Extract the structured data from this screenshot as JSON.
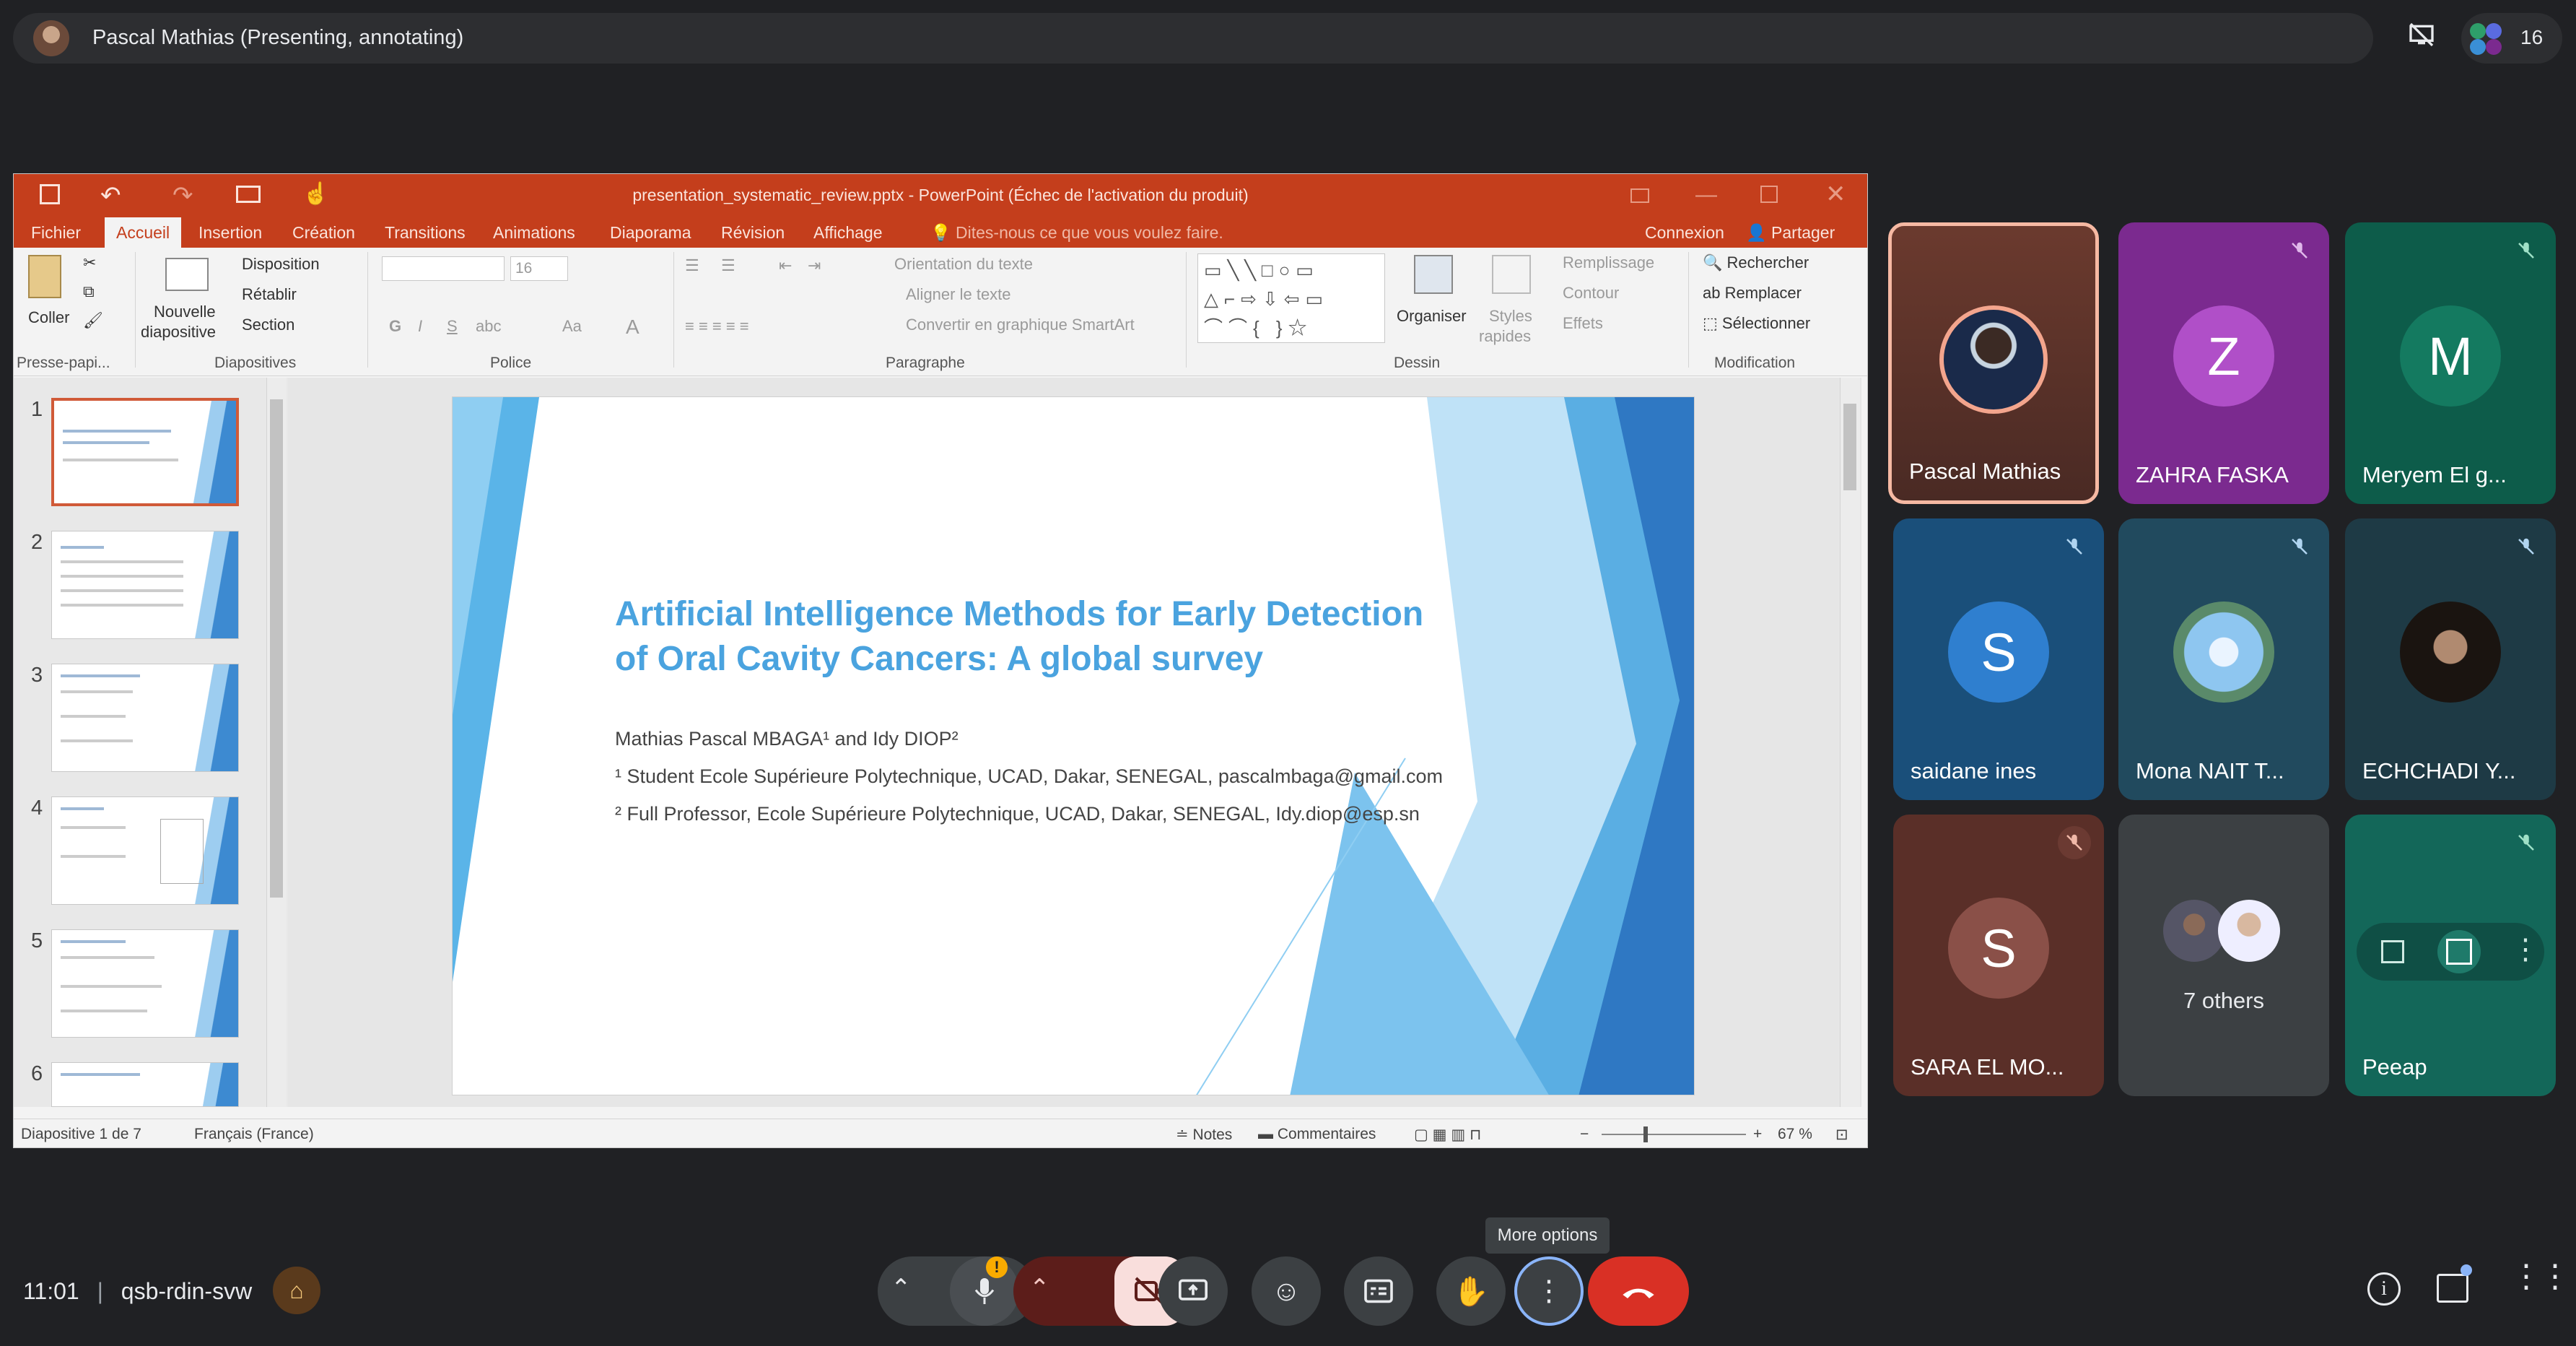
{
  "meeting": {
    "presenter_label": "Pascal Mathias (Presenting, annotating)",
    "participants_count": "16",
    "time": "11:01",
    "code": "qsb-rdin-svw",
    "tooltip": "More options"
  },
  "ppt": {
    "window_title": "presentation_systematic_review.pptx - PowerPoint (Échec de l'activation du produit)",
    "tabs": [
      "Fichier",
      "Accueil",
      "Insertion",
      "Création",
      "Transitions",
      "Animations",
      "Diaporama",
      "Révision",
      "Affichage"
    ],
    "tell_me": "Dites-nous ce que vous voulez faire.",
    "connexion": "Connexion",
    "share": "Partager",
    "ribbon": {
      "paste": "Coller",
      "new_slide_1": "Nouvelle",
      "new_slide_2": "diapositive",
      "layout": "Disposition",
      "reset": "Rétablir",
      "section": "Section",
      "font_size": "16",
      "text_direction": "Orientation du texte",
      "align_text": "Aligner le texte",
      "smartart": "Convertir en graphique SmartArt",
      "arrange": "Organiser",
      "quick_styles_1": "Styles",
      "quick_styles_2": "rapides",
      "fill": "Remplissage",
      "outline": "Contour",
      "effects": "Effets",
      "find": "Rechercher",
      "replace": "Remplacer",
      "select": "Sélectionner",
      "groups": {
        "clipboard": "Presse-papi...",
        "slides": "Diapositives",
        "font": "Police",
        "paragraph": "Paragraphe",
        "drawing": "Dessin",
        "editing": "Modification"
      }
    },
    "thumbnail_numbers": [
      "1",
      "2",
      "3",
      "4",
      "5",
      "6"
    ],
    "slide": {
      "title_line1": "Artificial Intelligence Methods for Early Detection",
      "title_line2": "of Oral Cavity Cancers: A global survey",
      "authors": "Mathias Pascal MBAGA¹ and Idy DIOP²",
      "affil1": "¹ Student Ecole Supérieure Polytechnique, UCAD, Dakar, SENEGAL, pascalmbaga@gmail.com",
      "affil2": "² Full Professor, Ecole Supérieure Polytechnique, UCAD, Dakar, SENEGAL, Idy.diop@esp.sn"
    },
    "status": {
      "slide_pos": "Diapositive 1 de 7",
      "language": "Français (France)",
      "notes": "Notes",
      "comments": "Commentaires",
      "zoom": "67 %"
    }
  },
  "participants": [
    {
      "name": "Pascal Mathias",
      "initial": "",
      "color": "#6b3a2e",
      "muted": false,
      "speaking": true
    },
    {
      "name": "ZAHRA FASKA",
      "initial": "Z",
      "color": "#7b2a8f",
      "muted": true
    },
    {
      "name": "Meryem El g...",
      "initial": "M",
      "color": "#0d5c4a",
      "muted": true
    },
    {
      "name": "saidane ines",
      "initial": "S",
      "color": "#1a4f7a",
      "muted": true
    },
    {
      "name": "Mona NAIT T...",
      "initial": "",
      "color": "#214a5e",
      "muted": true
    },
    {
      "name": "ECHCHADI Y...",
      "initial": "",
      "color": "#1e3a45",
      "muted": true
    },
    {
      "name": "SARA EL MO...",
      "initial": "S",
      "color": "#5a2f28",
      "muted": true
    },
    {
      "name": "7 others",
      "initial": "",
      "color": "#3c4043",
      "muted": false
    },
    {
      "name": "Peeap",
      "initial": "",
      "color": "#136759",
      "muted": true
    }
  ]
}
